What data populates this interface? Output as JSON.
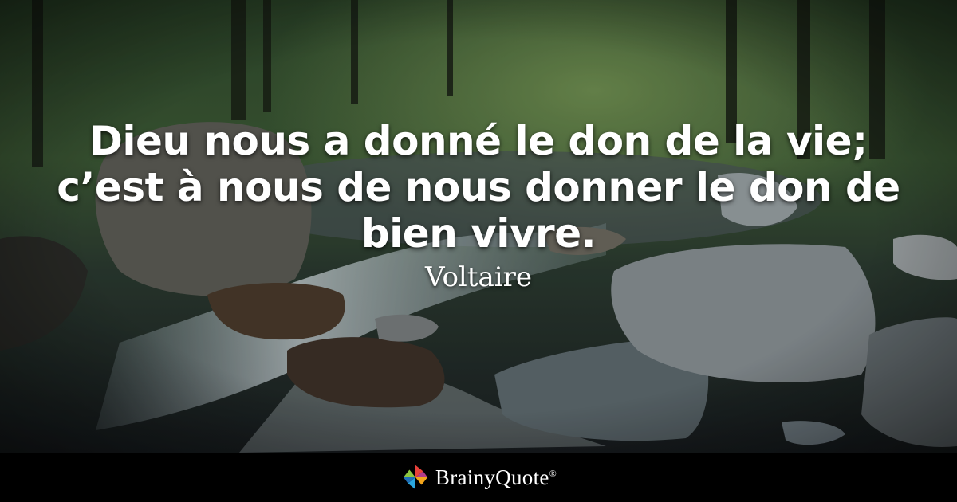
{
  "quote": {
    "text": "Dieu nous a donné le don de la vie; c’est à nous de nous donner le don de bien vivre.",
    "author": "Voltaire"
  },
  "footer": {
    "brand": "BrainyQuote",
    "trademark": "®",
    "logo_icon": "pinwheel-logo-icon"
  },
  "background": {
    "scene": "forest-stream-photo"
  }
}
